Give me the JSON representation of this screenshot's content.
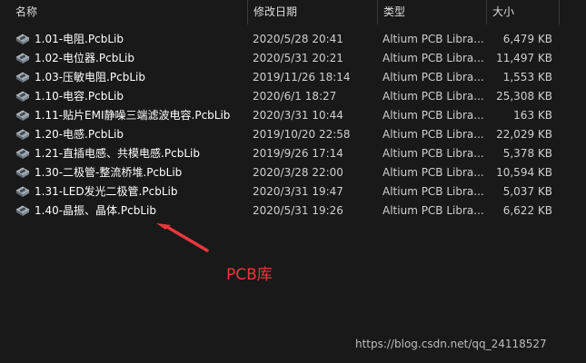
{
  "header": {
    "col_name": "名称",
    "col_date": "修改日期",
    "col_type": "类型",
    "col_size": "大小"
  },
  "files": [
    {
      "name": "1.01-电阻.PcbLib",
      "date": "2020/5/28 20:41",
      "type": "Altium PCB Libra...",
      "size": "6,479 KB"
    },
    {
      "name": "1.02-电位器.PcbLib",
      "date": "2020/5/31 20:21",
      "type": "Altium PCB Libra...",
      "size": "11,497 KB"
    },
    {
      "name": "1.03-压敏电阻.PcbLib",
      "date": "2019/11/26 18:14",
      "type": "Altium PCB Libra...",
      "size": "1,553 KB"
    },
    {
      "name": "1.10-电容.PcbLib",
      "date": "2020/6/1 18:27",
      "type": "Altium PCB Libra...",
      "size": "25,308 KB"
    },
    {
      "name": "1.11-贴片EMI静噪三端滤波电容.PcbLib",
      "date": "2020/3/31 10:44",
      "type": "Altium PCB Libra...",
      "size": "163 KB"
    },
    {
      "name": "1.20-电感.PcbLib",
      "date": "2019/10/20 22:58",
      "type": "Altium PCB Libra...",
      "size": "22,029 KB"
    },
    {
      "name": "1.21-直插电感、共模电感.PcbLib",
      "date": "2019/9/26 17:14",
      "type": "Altium PCB Libra...",
      "size": "5,378 KB"
    },
    {
      "name": "1.30-二极管-整流桥堆.PcbLib",
      "date": "2020/3/28 22:00",
      "type": "Altium PCB Libra...",
      "size": "10,594 KB"
    },
    {
      "name": "1.31-LED发光二极管.PcbLib",
      "date": "2020/3/31 19:47",
      "type": "Altium PCB Libra...",
      "size": "5,037 KB"
    },
    {
      "name": "1.40-晶振、晶体.PcbLib",
      "date": "2020/5/31 19:26",
      "type": "Altium PCB Libra...",
      "size": "6,622 KB"
    }
  ],
  "annotation": "PCB库",
  "watermark": "https://blog.csdn.net/qq_24118527",
  "colors": {
    "background": "#191919",
    "annotation": "#e8383d"
  },
  "icons": {
    "file": "pcblib-file-icon",
    "sort": "sort-up-icon"
  }
}
